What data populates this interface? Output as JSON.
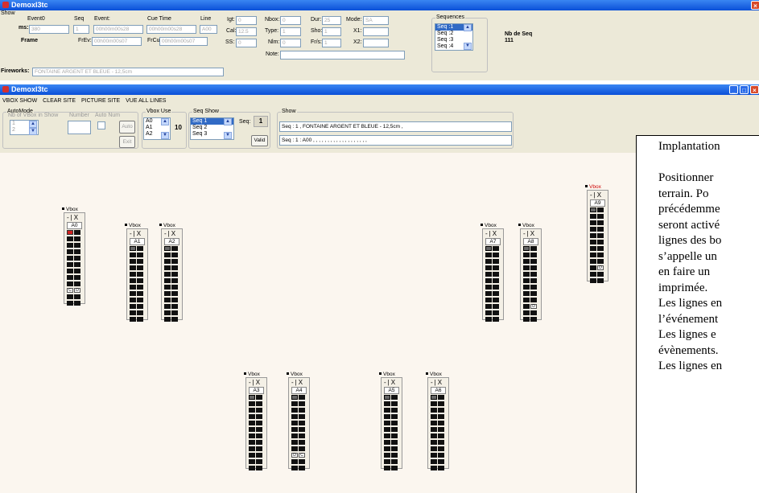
{
  "outer": {
    "title": "DemoxI3tc",
    "show_label": "Show",
    "event0_label": "Event0",
    "ms_label": "ms:",
    "ms_value": "380",
    "seq_label": "Seq",
    "seq_value": "1",
    "event_label": "Event:",
    "event_value": "00h00m00s28",
    "cue_time_label": "Cue Time",
    "cue_time_value": "00h00m00s28",
    "line_label": "Line",
    "line_value": "A00",
    "frame_label": "Frame",
    "frev_label": "FrEv:",
    "frev_value": "00h00m00s07",
    "frcu_label": "FrCu:",
    "frcu_value": "00h00m00s07",
    "igt_label": "Igt:",
    "igt_value": "0",
    "cal_label": "Cal:",
    "cal_value": "12.5",
    "ss_label": "SS:",
    "ss_value": "0",
    "nbox_label": "Nbox:",
    "nbox_value": "0",
    "type_label": "Type:",
    "type_value": "1",
    "nlm_label": "Nlm:",
    "nlm_value": "0",
    "dur_label": "Dur:",
    "dur_value": "25",
    "sho_label": "Sho:",
    "sho_value": "1",
    "frs_label": "Fr/s:",
    "frs_value": "1",
    "mode_label": "Mode:",
    "mode_value": "SA",
    "x1_label": "X1:",
    "x2_label": "X2:",
    "note_label": "Note:",
    "fireworks_label": "Fireworks:",
    "fireworks_value": "FONTAINE ARGENT ET BLEUE - 12,5cm",
    "sequences_label": "Sequences",
    "sequences": [
      "Seq :1",
      "Seq :2",
      "Seq :3",
      "Seq :4"
    ],
    "nb_seq_label": "Nb de Seq",
    "nb_seq_value": "111"
  },
  "inner": {
    "title": "DemoxI3tc",
    "menu": [
      "VBOX SHOW",
      "CLEAR SITE",
      "PICTURE SITE",
      "VUE ALL LINES"
    ],
    "automode_label": "AutoMode",
    "nb_vbox_label": "Nb of VBox in Show",
    "nb_vbox_items": [
      "1",
      "2"
    ],
    "number_label": "Number",
    "auto_num_label": "Auto Num",
    "auto_btn": "Auto",
    "exit_btn": "Exit",
    "vbox_use_label": "Vbox Use",
    "vbox_use_items": [
      "A0",
      "A1",
      "A2"
    ],
    "vbox_use_count": "10",
    "seq_show_label": "Seq Show",
    "seq_show_items": [
      "Seq 1",
      "Seq 2",
      "Seq 3"
    ],
    "seq_label": "Seq:",
    "seq_value": "1",
    "valid_btn": "Valid",
    "show_label": "Show",
    "show_line1": "Seq : 1 , FONTAINE ARGENT ET BLEUE - 12,5cm ,",
    "show_line2": "Seq : 1 :  A00 , , , , , , , , , , , , , , , , , , ,"
  },
  "vboxes": [
    {
      "caption": "Vbox",
      "ctl": "-|X",
      "name": "A0",
      "first": "red",
      "letters": [
        "C",
        "D"
      ]
    },
    {
      "caption": "Vbox",
      "ctl": "-|X",
      "name": "A1",
      "first": "grey",
      "letters": []
    },
    {
      "caption": "Vbox",
      "ctl": "-|X",
      "name": "A2",
      "first": "grey",
      "letters": []
    },
    {
      "caption": "Vbox",
      "ctl": "-|X",
      "name": "A3",
      "first": "grey",
      "letters": []
    },
    {
      "caption": "Vbox",
      "ctl": "-|X",
      "name": "A4",
      "first": "grey",
      "letters": [
        "D",
        "C"
      ]
    },
    {
      "caption": "Vbox",
      "ctl": "-|X",
      "name": "A5",
      "first": "grey",
      "letters": []
    },
    {
      "caption": "Vbox",
      "ctl": "-|X",
      "name": "A6",
      "first": "grey",
      "letters": []
    },
    {
      "caption": "Vbox",
      "ctl": "-|X",
      "name": "A7",
      "first": "grey",
      "letters": []
    },
    {
      "caption": "Vbox",
      "ctl": "-|X",
      "name": "A8",
      "first": "grey",
      "letters": [
        "D"
      ]
    },
    {
      "caption": "Vbox",
      "ctl": "-|X",
      "name": "A9",
      "first": "grey",
      "letters": [
        "D"
      ]
    }
  ],
  "overlay_text": [
    "Implantation",
    "",
    "Positionner",
    "terrain.   Po",
    "précédemme",
    "seront activé",
    "lignes des bo",
    "s’appelle un",
    "en faire un",
    "imprimée.",
    "Les lignes en",
    "l’événement",
    "Les lignes e",
    "évènements.",
    "Les lignes en"
  ],
  "colors": {
    "titlebar": "#0a4fd8",
    "canvas": "#fbf6ef",
    "panel": "#ece9d8",
    "selection": "#316ac5",
    "active_cell": "#d02020"
  }
}
